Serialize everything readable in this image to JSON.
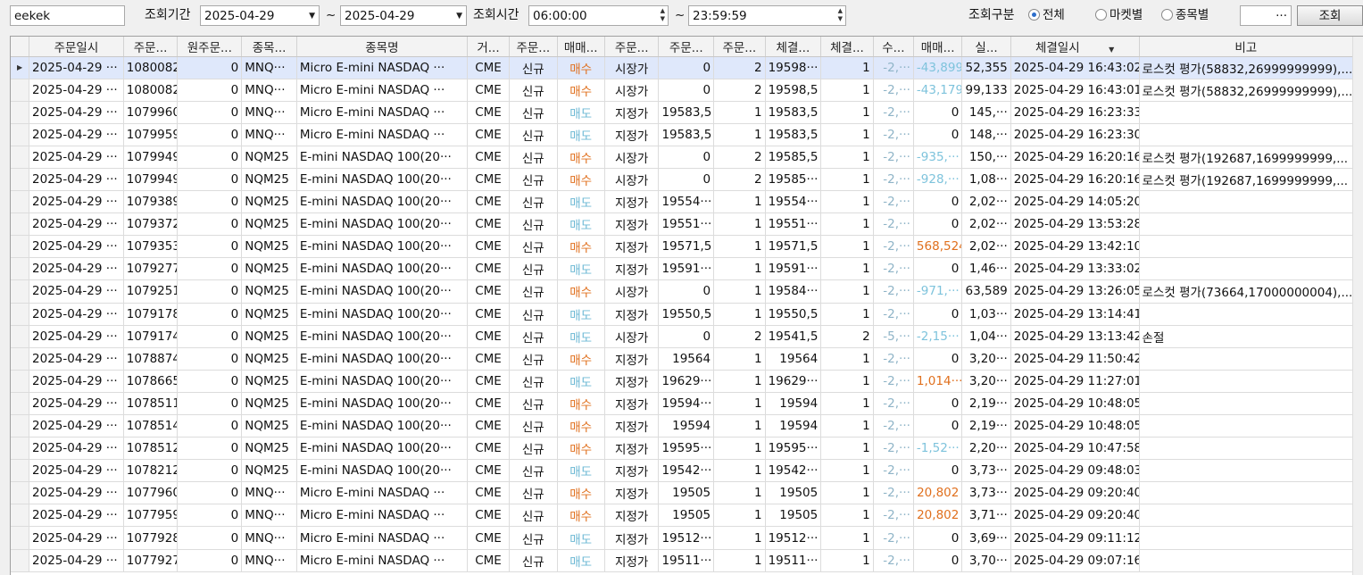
{
  "toolbar": {
    "account": "eekek",
    "period_label": "조회기간",
    "date_from": "2025-04-29",
    "tilde1": "~",
    "date_to": "2025-04-29",
    "time_label": "조회시간",
    "time_from": "06:00:00",
    "tilde2": "~",
    "time_to": "23:59:59",
    "type_label": "조회구분",
    "radio_all": "전체",
    "radio_market": "마켓별",
    "radio_item": "종목별",
    "selected_radio": "전체",
    "browse_btn": "···",
    "search_btn": "조회"
  },
  "columns": [
    "주문일시",
    "주문...",
    "원주문...",
    "종목...",
    "종목명",
    "거...",
    "주문...",
    "매매...",
    "주문...",
    "주문...",
    "주문...",
    "체결...",
    "체결...",
    "수...",
    "매매...",
    "실...",
    "체결일시",
    "비고"
  ],
  "sort_arrow": "▼",
  "selected_row_marker": "▶",
  "rows": [
    [
      "2025-04-29 ···",
      "1080082",
      "0",
      "MNQ···",
      "Micro E-mini NASDAQ ···",
      "CME",
      "신규",
      "매수",
      "시장가",
      "0",
      "2",
      "19598···",
      "1",
      "-2,···",
      "-43,899",
      "52,355",
      "2025-04-29 16:43:02",
      "로스컷 평가(58832,26999999999),..."
    ],
    [
      "2025-04-29 ···",
      "1080082",
      "0",
      "MNQ···",
      "Micro E-mini NASDAQ ···",
      "CME",
      "신규",
      "매수",
      "시장가",
      "0",
      "2",
      "19598,5",
      "1",
      "-2,···",
      "-43,179",
      "99,133",
      "2025-04-29 16:43:01",
      "로스컷 평가(58832,26999999999),..."
    ],
    [
      "2025-04-29 ···",
      "1079960",
      "0",
      "MNQ···",
      "Micro E-mini NASDAQ ···",
      "CME",
      "신규",
      "매도",
      "지정가",
      "19583,5",
      "1",
      "19583,5",
      "1",
      "-2,···",
      "0",
      "145,···",
      "2025-04-29 16:23:33",
      ""
    ],
    [
      "2025-04-29 ···",
      "1079959",
      "0",
      "MNQ···",
      "Micro E-mini NASDAQ ···",
      "CME",
      "신규",
      "매도",
      "지정가",
      "19583,5",
      "1",
      "19583,5",
      "1",
      "-2,···",
      "0",
      "148,···",
      "2025-04-29 16:23:30",
      ""
    ],
    [
      "2025-04-29 ···",
      "1079949",
      "0",
      "NQM25",
      "E-mini NASDAQ 100(20···",
      "CME",
      "신규",
      "매수",
      "시장가",
      "0",
      "2",
      "19585,5",
      "1",
      "-2,···",
      "-935,···",
      "150,···",
      "2025-04-29 16:20:16",
      "로스컷 평가(192687,1699999999,..."
    ],
    [
      "2025-04-29 ···",
      "1079949",
      "0",
      "NQM25",
      "E-mini NASDAQ 100(20···",
      "CME",
      "신규",
      "매수",
      "시장가",
      "0",
      "2",
      "19585···",
      "1",
      "-2,···",
      "-928,···",
      "1,08···",
      "2025-04-29 16:20:16",
      "로스컷 평가(192687,1699999999,..."
    ],
    [
      "2025-04-29 ···",
      "1079389",
      "0",
      "NQM25",
      "E-mini NASDAQ 100(20···",
      "CME",
      "신규",
      "매도",
      "지정가",
      "19554···",
      "1",
      "19554···",
      "1",
      "-2,···",
      "0",
      "2,02···",
      "2025-04-29 14:05:20",
      ""
    ],
    [
      "2025-04-29 ···",
      "1079372",
      "0",
      "NQM25",
      "E-mini NASDAQ 100(20···",
      "CME",
      "신규",
      "매도",
      "지정가",
      "19551···",
      "1",
      "19551···",
      "1",
      "-2,···",
      "0",
      "2,02···",
      "2025-04-29 13:53:28",
      ""
    ],
    [
      "2025-04-29 ···",
      "1079353",
      "0",
      "NQM25",
      "E-mini NASDAQ 100(20···",
      "CME",
      "신규",
      "매수",
      "지정가",
      "19571,5",
      "1",
      "19571,5",
      "1",
      "-2,···",
      "568,524",
      "2,02···",
      "2025-04-29 13:42:10",
      ""
    ],
    [
      "2025-04-29 ···",
      "1079277",
      "0",
      "NQM25",
      "E-mini NASDAQ 100(20···",
      "CME",
      "신규",
      "매도",
      "지정가",
      "19591···",
      "1",
      "19591···",
      "1",
      "-2,···",
      "0",
      "1,46···",
      "2025-04-29 13:33:02",
      ""
    ],
    [
      "2025-04-29 ···",
      "1079251",
      "0",
      "NQM25",
      "E-mini NASDAQ 100(20···",
      "CME",
      "신규",
      "매수",
      "시장가",
      "0",
      "1",
      "19584···",
      "1",
      "-2,···",
      "-971,···",
      "63,589",
      "2025-04-29 13:26:05",
      "로스컷 평가(73664,17000000004),..."
    ],
    [
      "2025-04-29 ···",
      "1079178",
      "0",
      "NQM25",
      "E-mini NASDAQ 100(20···",
      "CME",
      "신규",
      "매도",
      "지정가",
      "19550,5",
      "1",
      "19550,5",
      "1",
      "-2,···",
      "0",
      "1,03···",
      "2025-04-29 13:14:41",
      ""
    ],
    [
      "2025-04-29 ···",
      "1079174",
      "0",
      "NQM25",
      "E-mini NASDAQ 100(20···",
      "CME",
      "신규",
      "매도",
      "시장가",
      "0",
      "2",
      "19541,5",
      "2",
      "-5,···",
      "-2,15···",
      "1,04···",
      "2025-04-29 13:13:42",
      "손절"
    ],
    [
      "2025-04-29 ···",
      "1078874",
      "0",
      "NQM25",
      "E-mini NASDAQ 100(20···",
      "CME",
      "신규",
      "매수",
      "지정가",
      "19564",
      "1",
      "19564",
      "1",
      "-2,···",
      "0",
      "3,20···",
      "2025-04-29 11:50:42",
      ""
    ],
    [
      "2025-04-29 ···",
      "1078665",
      "0",
      "NQM25",
      "E-mini NASDAQ 100(20···",
      "CME",
      "신규",
      "매도",
      "지정가",
      "19629···",
      "1",
      "19629···",
      "1",
      "-2,···",
      "1,014···",
      "3,20···",
      "2025-04-29 11:27:01",
      ""
    ],
    [
      "2025-04-29 ···",
      "1078511",
      "0",
      "NQM25",
      "E-mini NASDAQ 100(20···",
      "CME",
      "신규",
      "매수",
      "지정가",
      "19594···",
      "1",
      "19594",
      "1",
      "-2,···",
      "0",
      "2,19···",
      "2025-04-29 10:48:05",
      ""
    ],
    [
      "2025-04-29 ···",
      "1078514",
      "0",
      "NQM25",
      "E-mini NASDAQ 100(20···",
      "CME",
      "신규",
      "매수",
      "지정가",
      "19594",
      "1",
      "19594",
      "1",
      "-2,···",
      "0",
      "2,19···",
      "2025-04-29 10:48:05",
      ""
    ],
    [
      "2025-04-29 ···",
      "1078512",
      "0",
      "NQM25",
      "E-mini NASDAQ 100(20···",
      "CME",
      "신규",
      "매수",
      "지정가",
      "19595···",
      "1",
      "19595···",
      "1",
      "-2,···",
      "-1,52···",
      "2,20···",
      "2025-04-29 10:47:58",
      ""
    ],
    [
      "2025-04-29 ···",
      "1078212",
      "0",
      "NQM25",
      "E-mini NASDAQ 100(20···",
      "CME",
      "신규",
      "매도",
      "지정가",
      "19542···",
      "1",
      "19542···",
      "1",
      "-2,···",
      "0",
      "3,73···",
      "2025-04-29 09:48:03",
      ""
    ],
    [
      "2025-04-29 ···",
      "1077960",
      "0",
      "MNQ···",
      "Micro E-mini NASDAQ ···",
      "CME",
      "신규",
      "매수",
      "지정가",
      "19505",
      "1",
      "19505",
      "1",
      "-2,···",
      "20,802",
      "3,73···",
      "2025-04-29 09:20:40",
      ""
    ],
    [
      "2025-04-29 ···",
      "1077959",
      "0",
      "MNQ···",
      "Micro E-mini NASDAQ ···",
      "CME",
      "신규",
      "매수",
      "지정가",
      "19505",
      "1",
      "19505",
      "1",
      "-2,···",
      "20,802",
      "3,71···",
      "2025-04-29 09:20:40",
      ""
    ],
    [
      "2025-04-29 ···",
      "1077928",
      "0",
      "MNQ···",
      "Micro E-mini NASDAQ ···",
      "CME",
      "신규",
      "매도",
      "지정가",
      "19512···",
      "1",
      "19512···",
      "1",
      "-2,···",
      "0",
      "3,69···",
      "2025-04-29 09:11:12",
      ""
    ],
    [
      "2025-04-29 ···",
      "1077927",
      "0",
      "MNQ···",
      "Micro E-mini NASDAQ ···",
      "CME",
      "신규",
      "매도",
      "지정가",
      "19511···",
      "1",
      "19511···",
      "1",
      "-2,···",
      "0",
      "3,70···",
      "2025-04-29 09:07:16",
      ""
    ]
  ],
  "buy_label": "매수",
  "sell_label": "매도",
  "colors": {
    "buy": "#e0701e",
    "sell": "#6cb8d4",
    "negative": "#7ec3dc",
    "positive": "#e0701e",
    "selection": "#dfe8fb"
  }
}
